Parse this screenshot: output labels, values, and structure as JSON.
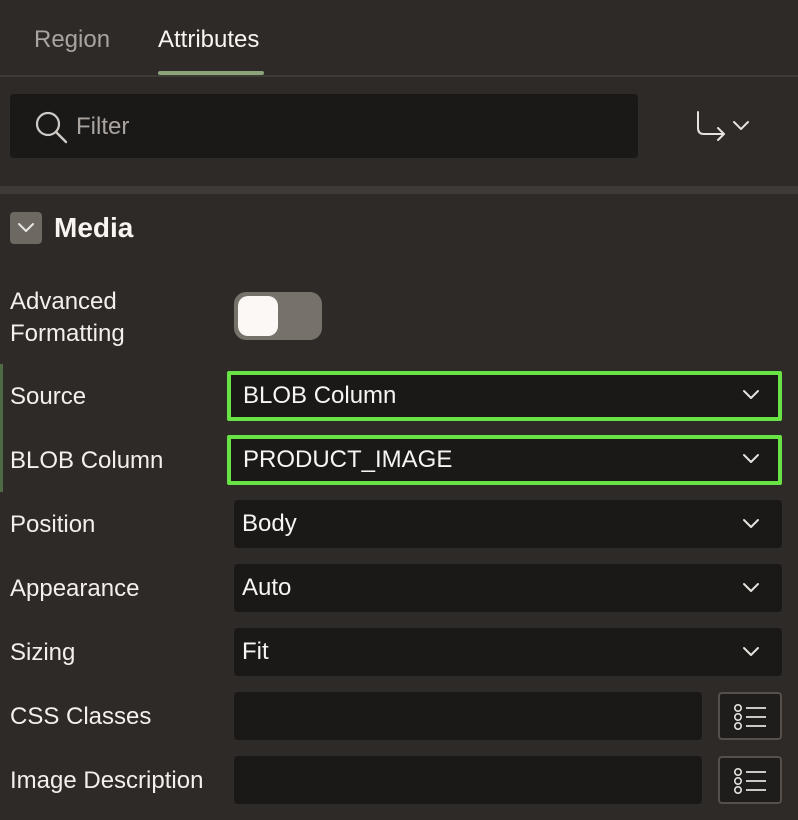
{
  "tabs": [
    {
      "label": "Region",
      "active": false
    },
    {
      "label": "Attributes",
      "active": true
    }
  ],
  "filter": {
    "placeholder": "Filter",
    "value": ""
  },
  "toolbar": {
    "goto_icon": "goto-group-icon"
  },
  "section": {
    "title": "Media",
    "expanded": true
  },
  "fields": {
    "advanced_formatting": {
      "label": "Advanced Formatting",
      "label_line1": "Advanced",
      "label_line2": "Formatting",
      "on": false
    },
    "source": {
      "label": "Source",
      "value": "BLOB Column"
    },
    "blob_column": {
      "label": "BLOB Column",
      "value": "PRODUCT_IMAGE"
    },
    "position": {
      "label": "Position",
      "value": "Body"
    },
    "appearance": {
      "label": "Appearance",
      "value": "Auto"
    },
    "sizing": {
      "label": "Sizing",
      "value": "Fit"
    },
    "css_classes": {
      "label": "CSS Classes",
      "value": ""
    },
    "image_description": {
      "label": "Image Description",
      "value": ""
    }
  },
  "colors": {
    "background": "#2d2a27",
    "field_bg": "#1b1918",
    "highlight": "#69e245",
    "tab_accent": "#8ba47a"
  }
}
